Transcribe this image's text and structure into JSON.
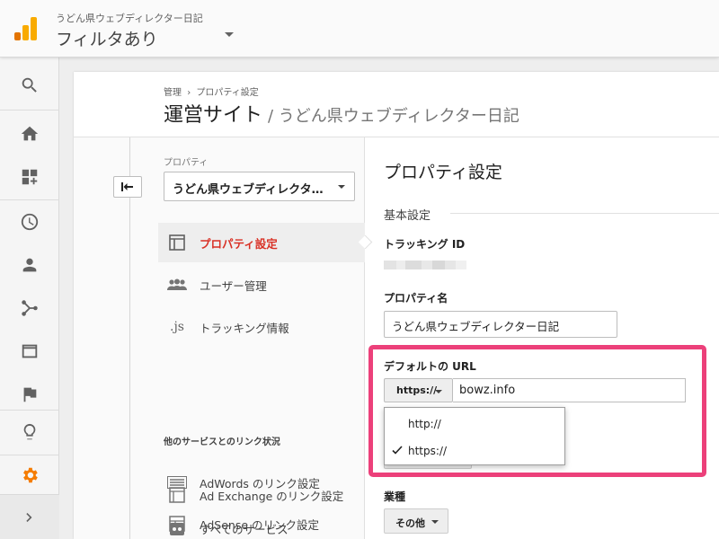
{
  "header": {
    "account_name": "うどん県ウェブディレクター日記",
    "view_name": "フィルタあり"
  },
  "leftnav": {
    "items": [
      "search-icon",
      "home-icon",
      "dashboard-add-icon",
      "clock-icon",
      "person-icon",
      "acquisition-icon",
      "behavior-icon",
      "flag-icon",
      "lightbulb-icon",
      "gear-icon"
    ],
    "active": "gear-icon",
    "bottom": "chevron-right-icon"
  },
  "breadcrumb": {
    "items": [
      "管理",
      "›",
      "プロパティ設定"
    ]
  },
  "page": {
    "title": "運営サイト",
    "subtitle": "/ うどん県ウェブディレクター日記"
  },
  "property_panel": {
    "label": "プロパティ",
    "selected": "うどん県ウェブディレクタ…"
  },
  "menu": {
    "items": [
      {
        "label": "プロパティ設定",
        "icon": "layout-icon",
        "active": true
      },
      {
        "label": "ユーザー管理",
        "icon": "users-icon",
        "active": false
      },
      {
        "label": "トラッキング情報",
        "icon": "js-icon",
        "active": false
      }
    ],
    "links_heading": "他のサービスとのリンク状況",
    "links": [
      {
        "label": "AdWords のリンク設定",
        "icon": "adwords-icon"
      },
      {
        "label": "AdSense のリンク設定",
        "icon": "adsense-icon"
      },
      {
        "label": "Ad Exchange のリンク設定",
        "icon": "adexchange-icon"
      },
      {
        "label": "すべてのサービス",
        "icon": "all-products-icon"
      }
    ]
  },
  "settings": {
    "title": "プロパティ設定",
    "basic_section": "基本設定",
    "tracking_id_label": "トラッキング ID",
    "property_name_label": "プロパティ名",
    "property_name_value": "うどん県ウェブディレクター日記",
    "default_url_label": "デフォルトの URL",
    "protocol_selected": "https://",
    "url_value": "bowz.info",
    "protocol_options": [
      "http://",
      "https://"
    ],
    "industry_label": "業種",
    "industry_value": "その他"
  },
  "colors": {
    "accent_orange": "#f57c00",
    "active_red": "#d93025",
    "highlight_pink": "#ec407a"
  }
}
